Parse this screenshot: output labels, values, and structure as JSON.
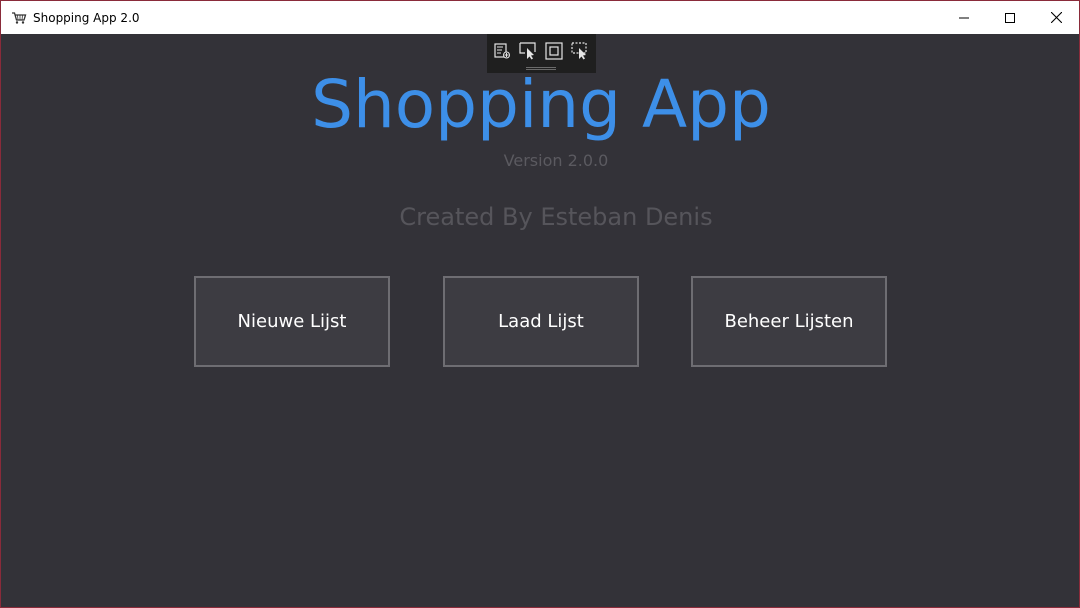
{
  "window": {
    "title": "Shopping App 2.0",
    "icon": "shopping-cart-icon",
    "controls": [
      "minimize-icon",
      "maximize-icon",
      "close-icon"
    ]
  },
  "dev_toolbar": {
    "tools": [
      "live-visual-tree-icon",
      "select-element-icon",
      "display-layout-adorners-icon",
      "track-focused-element-icon"
    ]
  },
  "main": {
    "title": "Shopping App",
    "version": "Version 2.0.0",
    "credits": "Created By Esteban Denis",
    "buttons": [
      {
        "label": "Nieuwe Lijst"
      },
      {
        "label": "Laad Lijst"
      },
      {
        "label": "Beheer Lijsten"
      }
    ]
  },
  "colors": {
    "background": "#333238",
    "accent": "#3d8fe8",
    "button_bg": "#3d3c42",
    "button_border": "#6e6d72",
    "muted_text": "#5b5a60"
  }
}
